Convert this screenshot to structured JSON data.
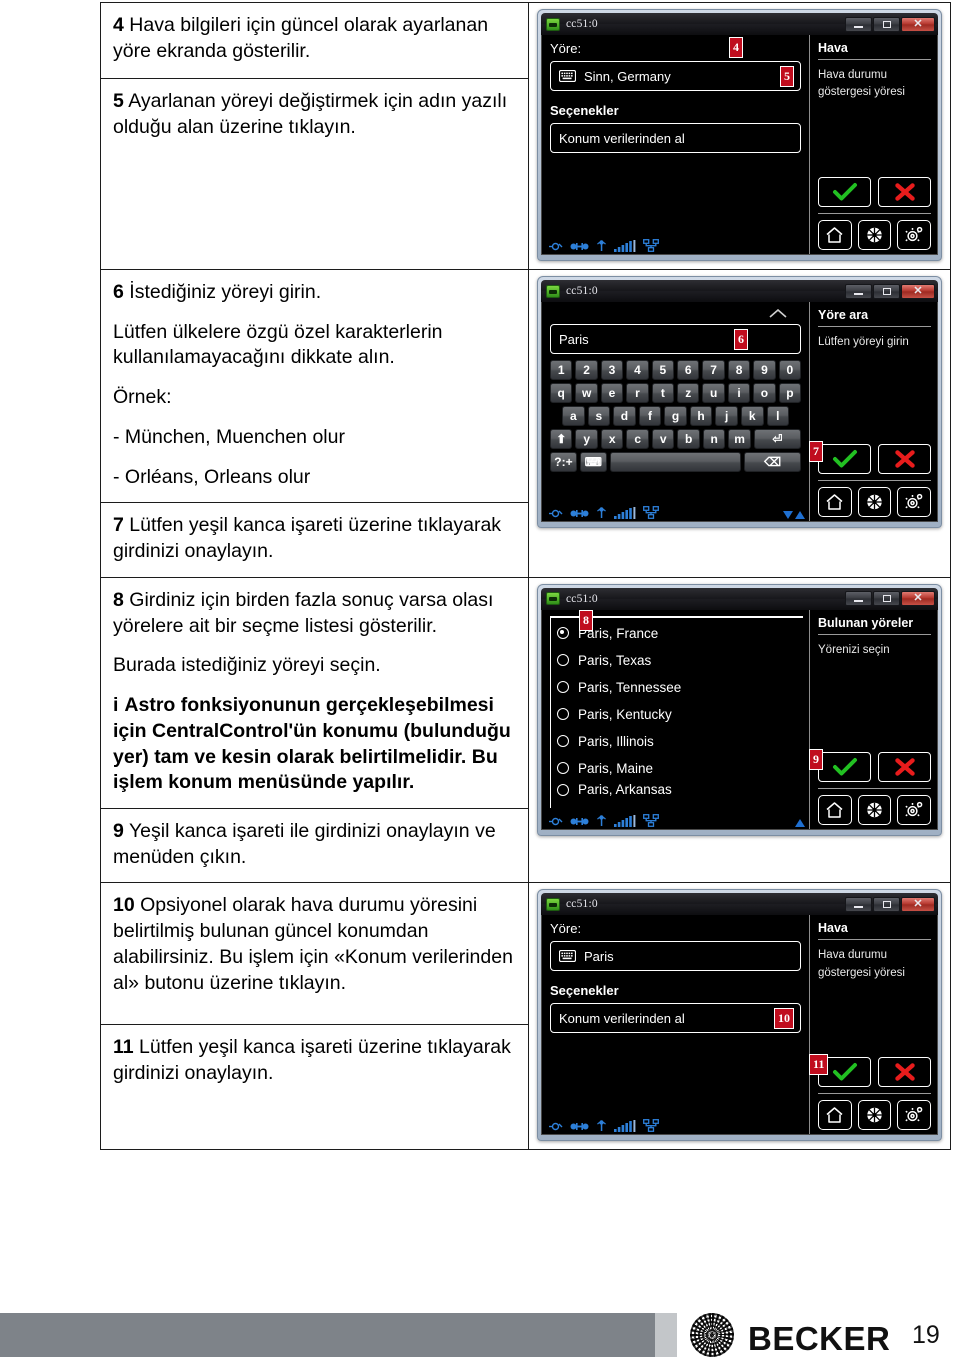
{
  "document": {
    "page_number": "19",
    "brand": "BECKER"
  },
  "steps": [
    {
      "number": "4",
      "text": "Hava bilgileri için güncel olarak ayarlanan yöre ekranda gösterilir."
    },
    {
      "number": "5",
      "text": "Ayarlanan yöreyi değiştirmek için adın yazılı olduğu alan üzerine tıklayın."
    },
    {
      "number": "6",
      "text": "İstediğiniz yöreyi girin."
    },
    {
      "number": "",
      "text": "Lütfen ülkelere özgü özel karakterlerin kullanılamayacağını dikkate alın."
    },
    {
      "number": "",
      "text": "Örnek:"
    },
    {
      "number": "",
      "text": "- München, Muenchen olur"
    },
    {
      "number": "",
      "text": "- Orléans, Orleans olur"
    },
    {
      "number": "7",
      "text": "Lütfen yeşil kanca işareti üzerine tıklayarak girdinizi onaylayın."
    },
    {
      "number": "8",
      "text": "Girdiniz için birden fazla sonuç varsa olası yörelere ait bir seçme listesi gösterilir."
    },
    {
      "number": "",
      "text": "Burada istediğiniz yöreyi seçin."
    },
    {
      "number": "i",
      "text": "Astro fonksiyonunun gerçekleşebilmesi için CentralControl'ün konumu (bulunduğu yer) tam ve kesin olarak belirtilmelidir. Bu işlem konum menüsünde yapılır."
    },
    {
      "number": "9",
      "text": "Yeşil kanca işareti ile girdinizi onaylayın ve menüden çıkın."
    },
    {
      "number": "10",
      "text": "Opsiyonel olarak hava durumu yöresini belirtilmiş bulunan güncel konumdan alabilirsiniz. Bu işlem için «Konum verilerinden al» butonu üzerine tıklayın."
    },
    {
      "number": "11",
      "text": "Lütfen yeşil kanca işareti üzerine tıklayarak girdinizi onaylayın."
    }
  ],
  "windows": {
    "weather_sinn": {
      "title": "cc51:0",
      "minimize_label": "",
      "maximize_label": "",
      "close_label": "✕",
      "region_label": "Yöre:",
      "region_value": "Sinn, Germany",
      "options_label": "Seçenekler",
      "option_button": "Konum verilerinden al",
      "panel_title": "Hava",
      "panel_sub": "Hava durumu göstergesi yöresi",
      "badges": {
        "field_top": "4",
        "field_value": "5"
      }
    },
    "search_keyboard": {
      "title": "cc51:0",
      "close_label": "✕",
      "search_value": "Paris",
      "panel_title": "Yöre ara",
      "panel_sub": "Lütfen yöreyi girin",
      "keyboard": {
        "row1": [
          "1",
          "2",
          "3",
          "4",
          "5",
          "6",
          "7",
          "8",
          "9",
          "0"
        ],
        "row2": [
          "q",
          "w",
          "e",
          "r",
          "t",
          "z",
          "u",
          "i",
          "o",
          "p"
        ],
        "row3": [
          "a",
          "s",
          "d",
          "f",
          "g",
          "h",
          "j",
          "k",
          "l"
        ],
        "row4": [
          "⬆",
          "y",
          "x",
          "c",
          "v",
          "b",
          "n",
          "m",
          "⏎"
        ],
        "row5": [
          "?:+",
          "⌨",
          "",
          "⌫"
        ]
      },
      "badges": {
        "input": "6",
        "confirm": "7"
      }
    },
    "city_list": {
      "title": "cc51:0",
      "close_label": "✕",
      "panel_title": "Bulunan yöreler",
      "panel_sub": "Yörenizi seçin",
      "items": [
        {
          "label": "Paris, France",
          "selected": true
        },
        {
          "label": "Paris, Texas",
          "selected": false
        },
        {
          "label": "Paris, Tennessee",
          "selected": false
        },
        {
          "label": "Paris, Kentucky",
          "selected": false
        },
        {
          "label": "Paris, Illinois",
          "selected": false
        },
        {
          "label": "Paris, Maine",
          "selected": false
        },
        {
          "label": "Paris, Arkansas",
          "selected": false
        }
      ],
      "badges": {
        "list": "8",
        "confirm": "9"
      }
    },
    "weather_paris": {
      "title": "cc51:0",
      "close_label": "✕",
      "region_label": "Yöre:",
      "region_value": "Paris",
      "options_label": "Seçenekler",
      "option_button": "Konum verilerinden al",
      "panel_title": "Hava",
      "panel_sub": "Hava durumu göstergesi yöresi",
      "badges": {
        "option": "10",
        "confirm": "11"
      }
    }
  },
  "icons": {
    "keyboard": "keyboard-icon",
    "check": "check-icon",
    "cross": "cross-icon",
    "home": "home-icon",
    "scene": "scene-icon",
    "gear": "gear-icon",
    "power": "power-icon",
    "link": "link-icon",
    "antenna": "antenna-icon",
    "signal": "signal-icon",
    "network": "network-icon"
  },
  "colors": {
    "accent_red": "#c00d1e",
    "check_green": "#22c022",
    "cross_red": "#e81c1c",
    "status_blue": "#1f6fd0",
    "footer_gray": "#7e8389"
  }
}
